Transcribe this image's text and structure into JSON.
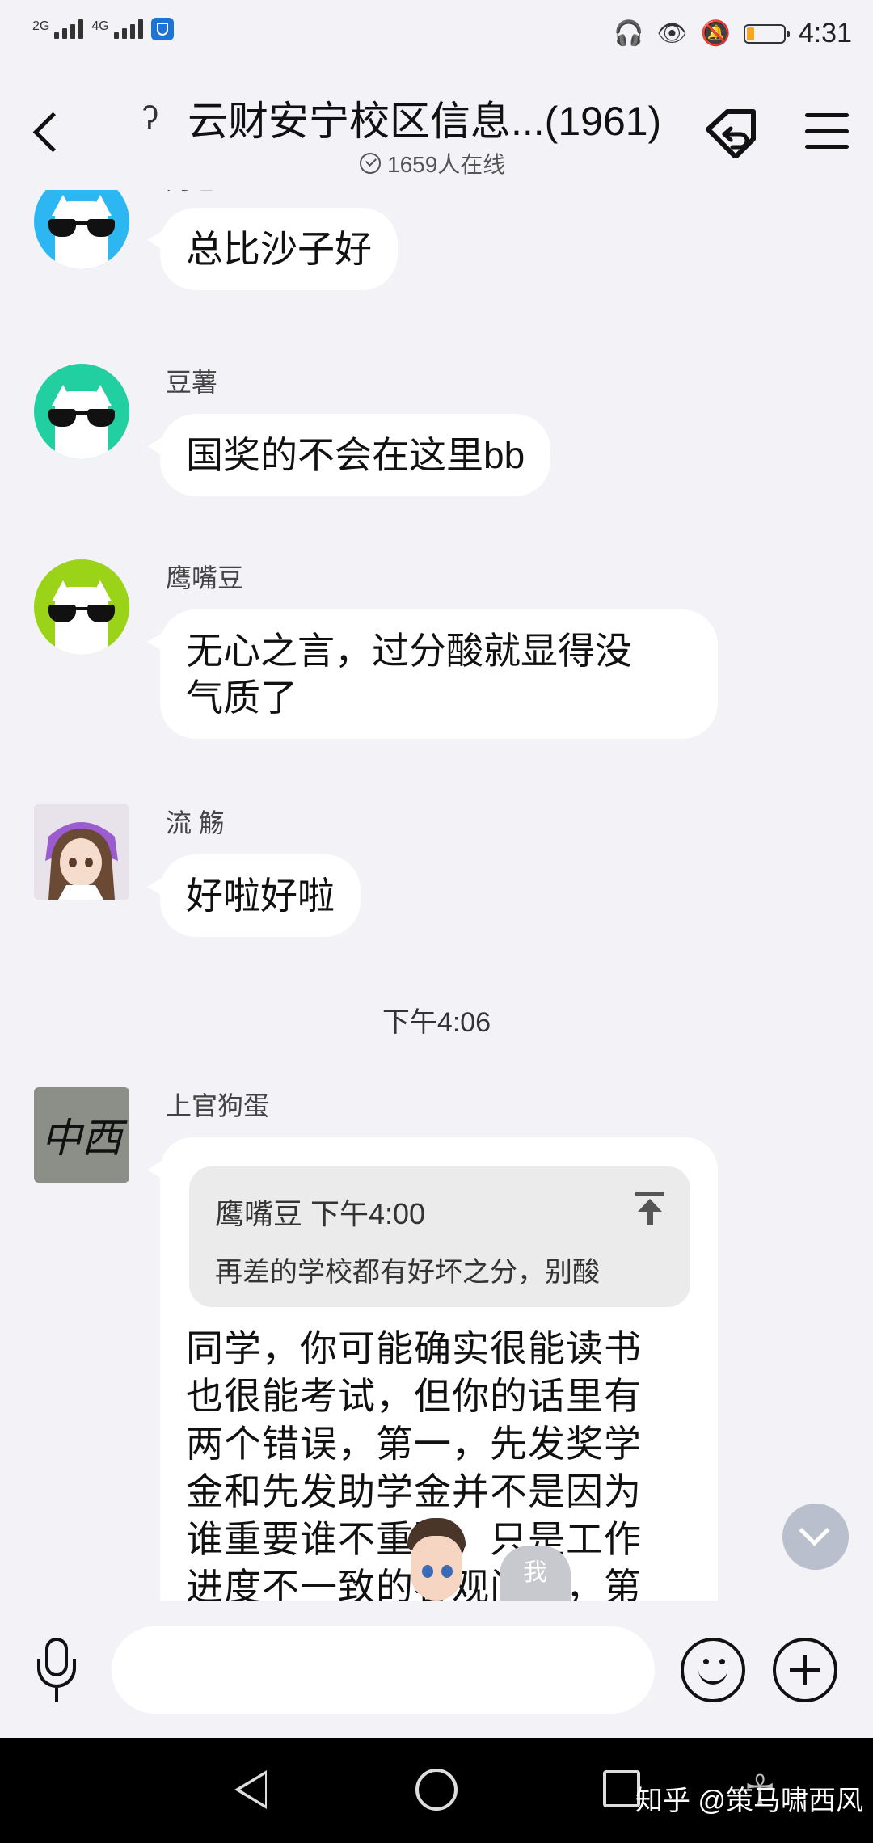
{
  "status_bar": {
    "sim1": "2G",
    "sim2": "4G",
    "time": "4:31",
    "battery_percent": 20
  },
  "header": {
    "title": "云财安宁校区信息...(1961)",
    "online": "1659人在线"
  },
  "messages": [
    {
      "name": "阿也",
      "text": "总比沙子好",
      "avatar_color": "#2cb7f2"
    },
    {
      "name": "豆薯",
      "text": "国奖的不会在这里bb",
      "avatar_color": "#22cfa0"
    },
    {
      "name": "鹰嘴豆",
      "text_lines": [
        "无心之言，过分酸就显得没",
        "气质了"
      ],
      "avatar_color": "#9ad318"
    },
    {
      "name": "流 觞",
      "text": "好啦好啦"
    }
  ],
  "time_separator": "下午4:06",
  "quoted_message": {
    "name": "上官狗蛋",
    "avatar_text": "中西",
    "quote_header": "鹰嘴豆 下午4:00",
    "quote_text": "再差的学校都有好坏之分，别酸",
    "body_lines": [
      "同学，你可能确实很能读书",
      "也很能考试，但你的话里有",
      "两个错误，第一，先发奖学",
      "金和先发助学金并不是因为",
      "谁重要谁不重要，只是工作",
      "进度不一致的客观问题，第"
    ]
  },
  "overlays": {
    "me_badge": "我"
  },
  "input": {
    "value": "",
    "placeholder": ""
  },
  "watermark": "知乎 @策马啸西风"
}
